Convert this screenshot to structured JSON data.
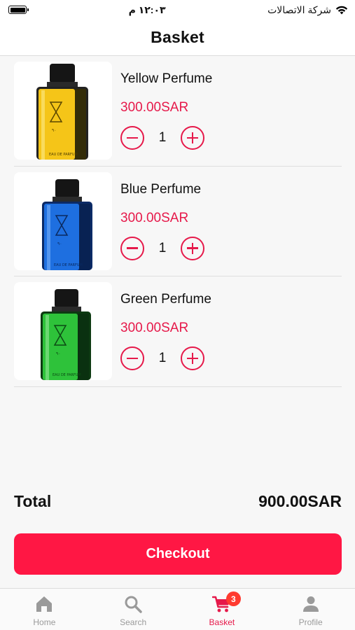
{
  "status_bar": {
    "time": "١٢:٠٣ م",
    "carrier": "شركة الاتصالات"
  },
  "header": {
    "title": "Basket"
  },
  "items": [
    {
      "name": "Yellow Perfume",
      "price": "300.00SAR",
      "quantity": "1",
      "color": "#f5c518"
    },
    {
      "name": "Blue Perfume",
      "price": "300.00SAR",
      "quantity": "1",
      "color": "#1e6fe0"
    },
    {
      "name": "Green Perfume",
      "price": "300.00SAR",
      "quantity": "1",
      "color": "#2ec23a"
    }
  ],
  "summary": {
    "total_label": "Total",
    "total_value": "900.00SAR"
  },
  "checkout": {
    "label": "Checkout"
  },
  "tabbar": {
    "tabs": [
      {
        "label": "Home",
        "icon": "home-icon"
      },
      {
        "label": "Search",
        "icon": "search-icon"
      },
      {
        "label": "Basket",
        "icon": "cart-icon",
        "badge": "3",
        "active": true
      },
      {
        "label": "Profile",
        "icon": "person-icon"
      }
    ]
  },
  "colors": {
    "accent": "#e6194a",
    "button": "#ff1744",
    "badge": "#ff3b30"
  }
}
